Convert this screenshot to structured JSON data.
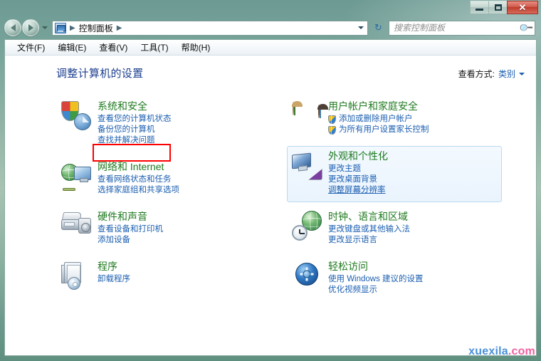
{
  "window": {
    "controls": {
      "minimize": "最小化",
      "maximize": "最大化",
      "close": "关闭",
      "close_glyph": "✕"
    }
  },
  "addressbar": {
    "back": "后退",
    "forward": "前进",
    "history_dropdown": "最近浏览的位置",
    "icon": "control-panel-icon",
    "breadcrumbs": [
      "控制面板"
    ],
    "separator": "▶",
    "dropdown": "▼",
    "refresh": "↻"
  },
  "search": {
    "placeholder": "搜索控制面板",
    "value": "",
    "icon": "search-icon"
  },
  "menubar": {
    "items": [
      {
        "label": "文件(F)",
        "key": "F"
      },
      {
        "label": "编辑(E)",
        "key": "E"
      },
      {
        "label": "查看(V)",
        "key": "V"
      },
      {
        "label": "工具(T)",
        "key": "T"
      },
      {
        "label": "帮助(H)",
        "key": "H"
      }
    ]
  },
  "page": {
    "title": "调整计算机的设置",
    "viewby": {
      "label": "查看方式:",
      "value": "类别",
      "caret": "▼"
    }
  },
  "categories": {
    "left": [
      {
        "name": "系统和安全",
        "icon": "security-shield-icon",
        "highlighted": false,
        "links": [
          {
            "text": "查看您的计算机状态",
            "shield": false,
            "underline": false
          },
          {
            "text": "备份您的计算机",
            "shield": false,
            "underline": false
          },
          {
            "text": "查找并解决问题",
            "shield": false,
            "underline": false
          }
        ]
      },
      {
        "name": "网络和 Internet",
        "icon": "network-globe-icon",
        "highlighted": false,
        "annotated": true,
        "links": [
          {
            "text": "查看网络状态和任务",
            "shield": false,
            "underline": false
          },
          {
            "text": "选择家庭组和共享选项",
            "shield": false,
            "underline": false
          }
        ]
      },
      {
        "name": "硬件和声音",
        "icon": "printer-speaker-icon",
        "highlighted": false,
        "links": [
          {
            "text": "查看设备和打印机",
            "shield": false,
            "underline": false
          },
          {
            "text": "添加设备",
            "shield": false,
            "underline": false
          }
        ]
      },
      {
        "name": "程序",
        "icon": "programs-box-icon",
        "highlighted": false,
        "links": [
          {
            "text": "卸载程序",
            "shield": false,
            "underline": false
          }
        ]
      }
    ],
    "right": [
      {
        "name": "用户帐户和家庭安全",
        "icon": "users-icon",
        "highlighted": false,
        "links": [
          {
            "text": "添加或删除用户帐户",
            "shield": true,
            "underline": false
          },
          {
            "text": "为所有用户设置家长控制",
            "shield": true,
            "underline": false
          }
        ]
      },
      {
        "name": "外观和个性化",
        "icon": "display-personalization-icon",
        "highlighted": true,
        "links": [
          {
            "text": "更改主题",
            "shield": false,
            "underline": false
          },
          {
            "text": "更改桌面背景",
            "shield": false,
            "underline": false
          },
          {
            "text": "调整屏幕分辨率",
            "shield": false,
            "underline": true
          }
        ]
      },
      {
        "name": "时钟、语言和区域",
        "icon": "clock-globe-icon",
        "highlighted": false,
        "links": [
          {
            "text": "更改键盘或其他输入法",
            "shield": false,
            "underline": false
          },
          {
            "text": "更改显示语言",
            "shield": false,
            "underline": false
          }
        ]
      },
      {
        "name": "轻松访问",
        "icon": "ease-of-access-icon",
        "highlighted": false,
        "links": [
          {
            "text": "使用 Windows 建议的设置",
            "shield": false,
            "underline": false
          },
          {
            "text": "优化视频显示",
            "shield": false,
            "underline": false
          }
        ]
      }
    ]
  },
  "annotation": {
    "color": "#ff0000",
    "target": "网络和 Internet"
  },
  "watermark": {
    "part1": "xuexila",
    "part2": ".com"
  },
  "colors": {
    "category_title": "#1f7a1f",
    "link": "#1c5fb0",
    "page_title": "#1c3f8f",
    "annotation": "#ff0000",
    "frame": "#78a49b",
    "highlight_bg": "#eaf4fd"
  }
}
